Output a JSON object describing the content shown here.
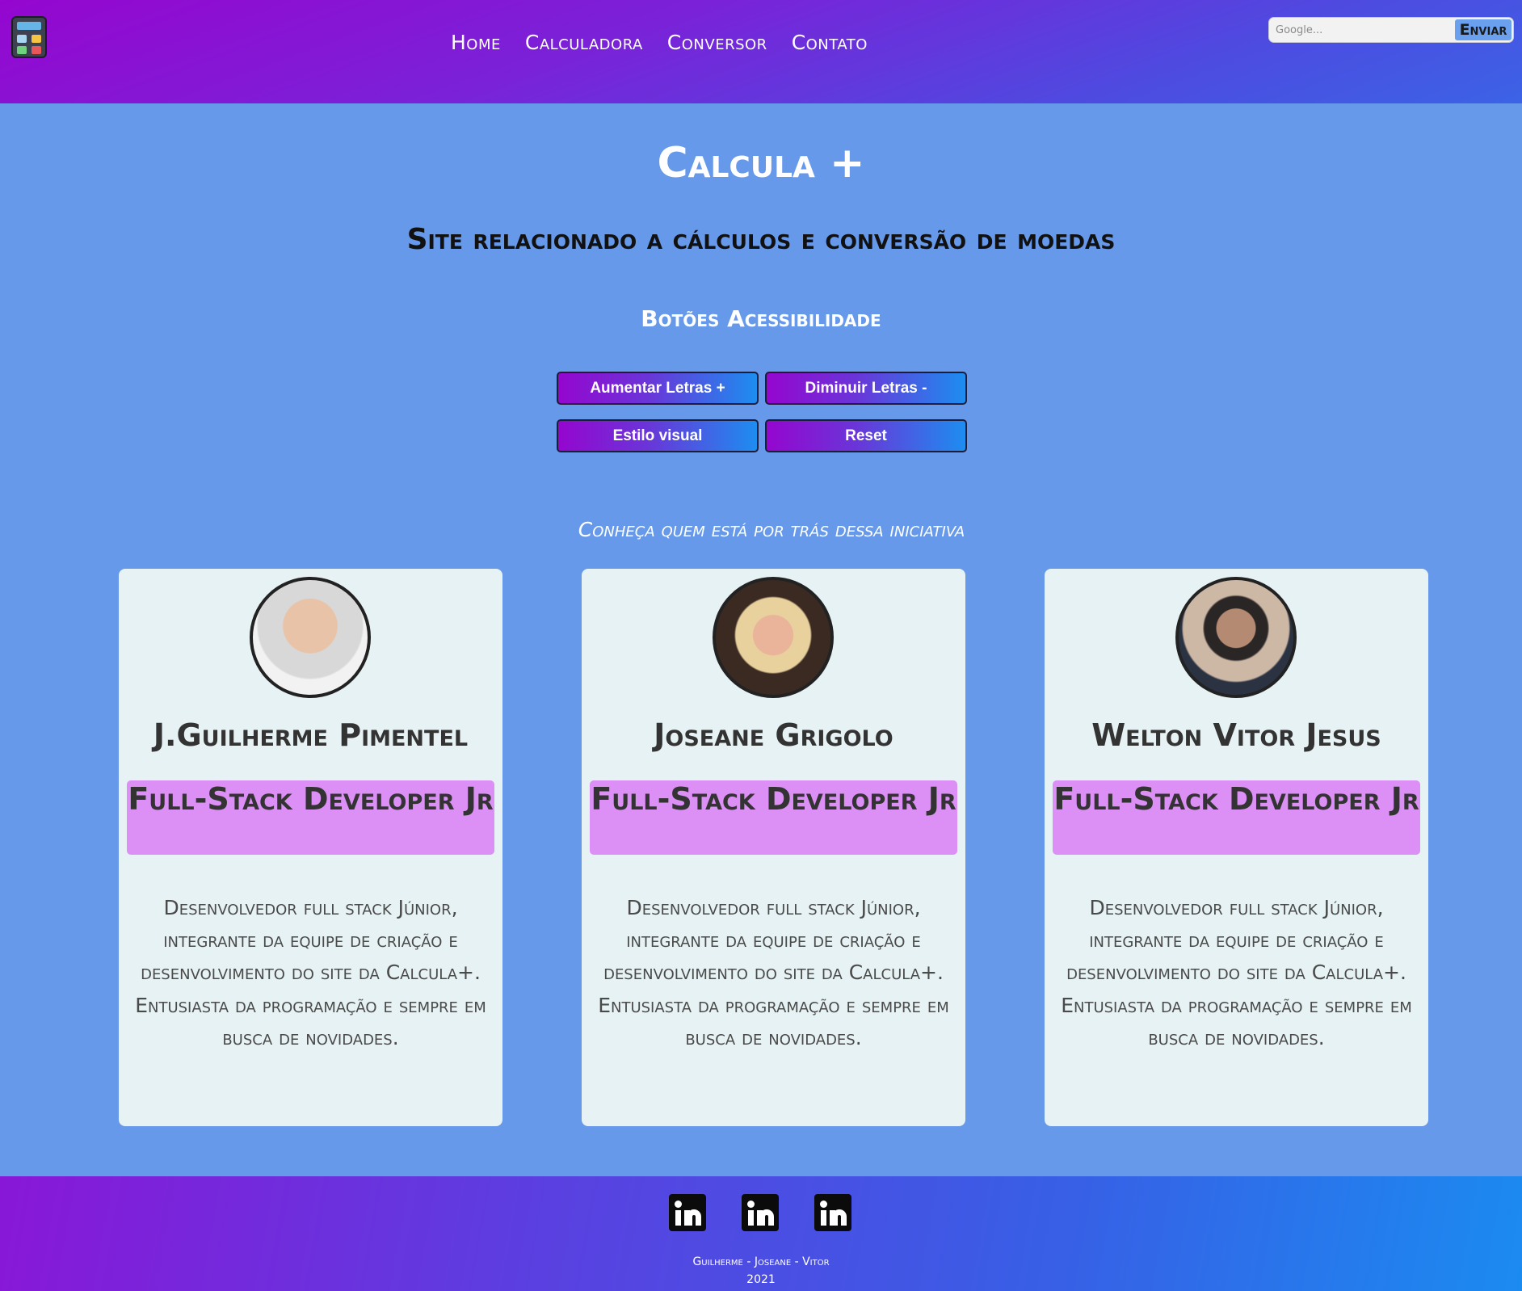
{
  "header": {
    "logo_icon": "calculator-icon",
    "nav": [
      "Home",
      "Calculadora",
      "Conversor",
      "Contato"
    ],
    "search": {
      "placeholder": "Google...",
      "button": "Enviar"
    }
  },
  "main": {
    "title": "Calcula +",
    "subtitle": "Site relacionado a cálculos e conversão de moedas",
    "accessibility": {
      "heading": "Botões Acessibilidade",
      "buttons": [
        "Aumentar Letras +",
        "Diminuir Letras -",
        "Estilo visual",
        "Reset"
      ]
    },
    "intro": "Conheça quem está por trás dessa iniciativa",
    "team": [
      {
        "name": "J.Guilherme Pimentel",
        "role": "Full-Stack Developer Jr",
        "description": "Desenvolvedor full stack Júnior, integrante da equipe de criação e desenvolvimento do site da Calcula+. Entusiasta da programação e sempre em busca de novidades."
      },
      {
        "name": "Joseane Grigolo",
        "role": "Full-Stack Developer Jr",
        "description": "Desenvolvedor full stack Júnior, integrante da equipe de criação e desenvolvimento do site da Calcula+. Entusiasta da programação e sempre em busca de novidades."
      },
      {
        "name": "Welton Vitor Jesus",
        "role": "Full-Stack Developer Jr",
        "description": "Desenvolvedor full stack Júnior, integrante da equipe de criação e desenvolvimento do site da Calcula+. Entusiasta da programação e sempre em busca de novidades."
      }
    ]
  },
  "footer": {
    "social_icons": [
      "linkedin-icon",
      "linkedin-icon",
      "linkedin-icon"
    ],
    "credits": "Guilherme - Joseane - Vitor",
    "year": "2021"
  },
  "colors": {
    "header_start": "#9506cf",
    "header_end": "#3b63e6",
    "main_bg": "#6699ea",
    "card_bg": "#e6f2f3",
    "role_bg": "#dc8ff5"
  }
}
